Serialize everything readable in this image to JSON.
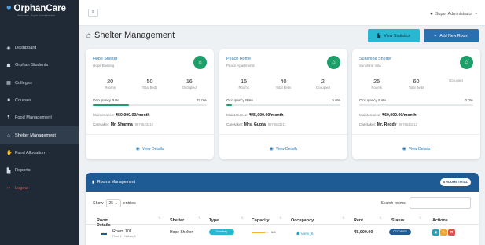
{
  "app": {
    "name": "OrphanCare",
    "tagline": "Welcome, Super Administrator"
  },
  "sidebar": {
    "items": [
      {
        "label": "Dashboard",
        "icon": "dashboard-icon"
      },
      {
        "label": "Orphan Students",
        "icon": "users-icon"
      },
      {
        "label": "Colleges",
        "icon": "college-icon"
      },
      {
        "label": "Courses",
        "icon": "book-icon"
      },
      {
        "label": "Food Management",
        "icon": "utensils-icon"
      },
      {
        "label": "Shelter Management",
        "icon": "home-icon",
        "active": true
      },
      {
        "label": "Fund Allocation",
        "icon": "hand-coin-icon"
      },
      {
        "label": "Reports",
        "icon": "chart-icon"
      },
      {
        "label": "Logout",
        "icon": "logout-icon"
      }
    ]
  },
  "topbar": {
    "user": "Super Administrator"
  },
  "page": {
    "title": "Shelter Management"
  },
  "actions": {
    "stats_label": "View Statistics",
    "add_label": "Add New Room"
  },
  "labels": {
    "rooms": "Rooms",
    "total_beds": "Total Beds",
    "occupied": "Occupied",
    "occupancy_rate": "Occupancy Rate",
    "maintenance": "Maintenance:",
    "caretaker": "Caretaker:",
    "view_details": "View Details"
  },
  "shelters": [
    {
      "name": "Hope Shelter",
      "building": "Hope Building",
      "rooms": "20",
      "total_beds": "50",
      "occupied": "16",
      "occupied_label": "Occupied",
      "rate": "32.0%",
      "rate_value": 0.32,
      "maintenance": "₹50,000.00/month",
      "caretaker": "Mr. Sharma",
      "phone": "9876543210"
    },
    {
      "name": "Peace Home",
      "building": "Peace Apartments",
      "rooms": "15",
      "total_beds": "40",
      "occupied": "2",
      "occupied_label": "Occupied",
      "rate": "5.0%",
      "rate_value": 0.05,
      "maintenance": "₹45,000.00/month",
      "caretaker": "Mrs. Gupta",
      "phone": "9876543211"
    },
    {
      "name": "Sunshine Shelter",
      "building": "Sunshine Villa",
      "rooms": "25",
      "total_beds": "60",
      "occupied": "",
      "occupied_label": "Occupied",
      "rate": "0.0%",
      "rate_value": 0.0,
      "maintenance": "₹60,000.00/month",
      "caretaker": "Mr. Reddy",
      "phone": "9876543212"
    }
  ],
  "rooms_panel": {
    "title": "Rooms Management",
    "total_badge": "8 ROOMS TOTAL",
    "show_label": "Show",
    "page_size": "25",
    "entries_label": "entries",
    "search_label": "Search rooms:",
    "columns": [
      "Room Details",
      "Shelter",
      "Type",
      "Capacity",
      "Occupancy",
      "Rent",
      "Status",
      "Actions"
    ],
    "rows": [
      {
        "room": "Room 101",
        "floor": "Floor 1 • N/A sq ft",
        "shelter": "Hope Shelter",
        "type": "Dormitory",
        "capacity": "6/8",
        "capacity_value": 0.75,
        "occupancy": "View (6)",
        "rent": "₹8,000.00",
        "status": "OCCUPIED"
      }
    ]
  },
  "colors": {
    "sidebar": "#1f2a36",
    "accent": "#2a6fb0",
    "success": "#1e9f6a",
    "info": "#28b8d2"
  }
}
